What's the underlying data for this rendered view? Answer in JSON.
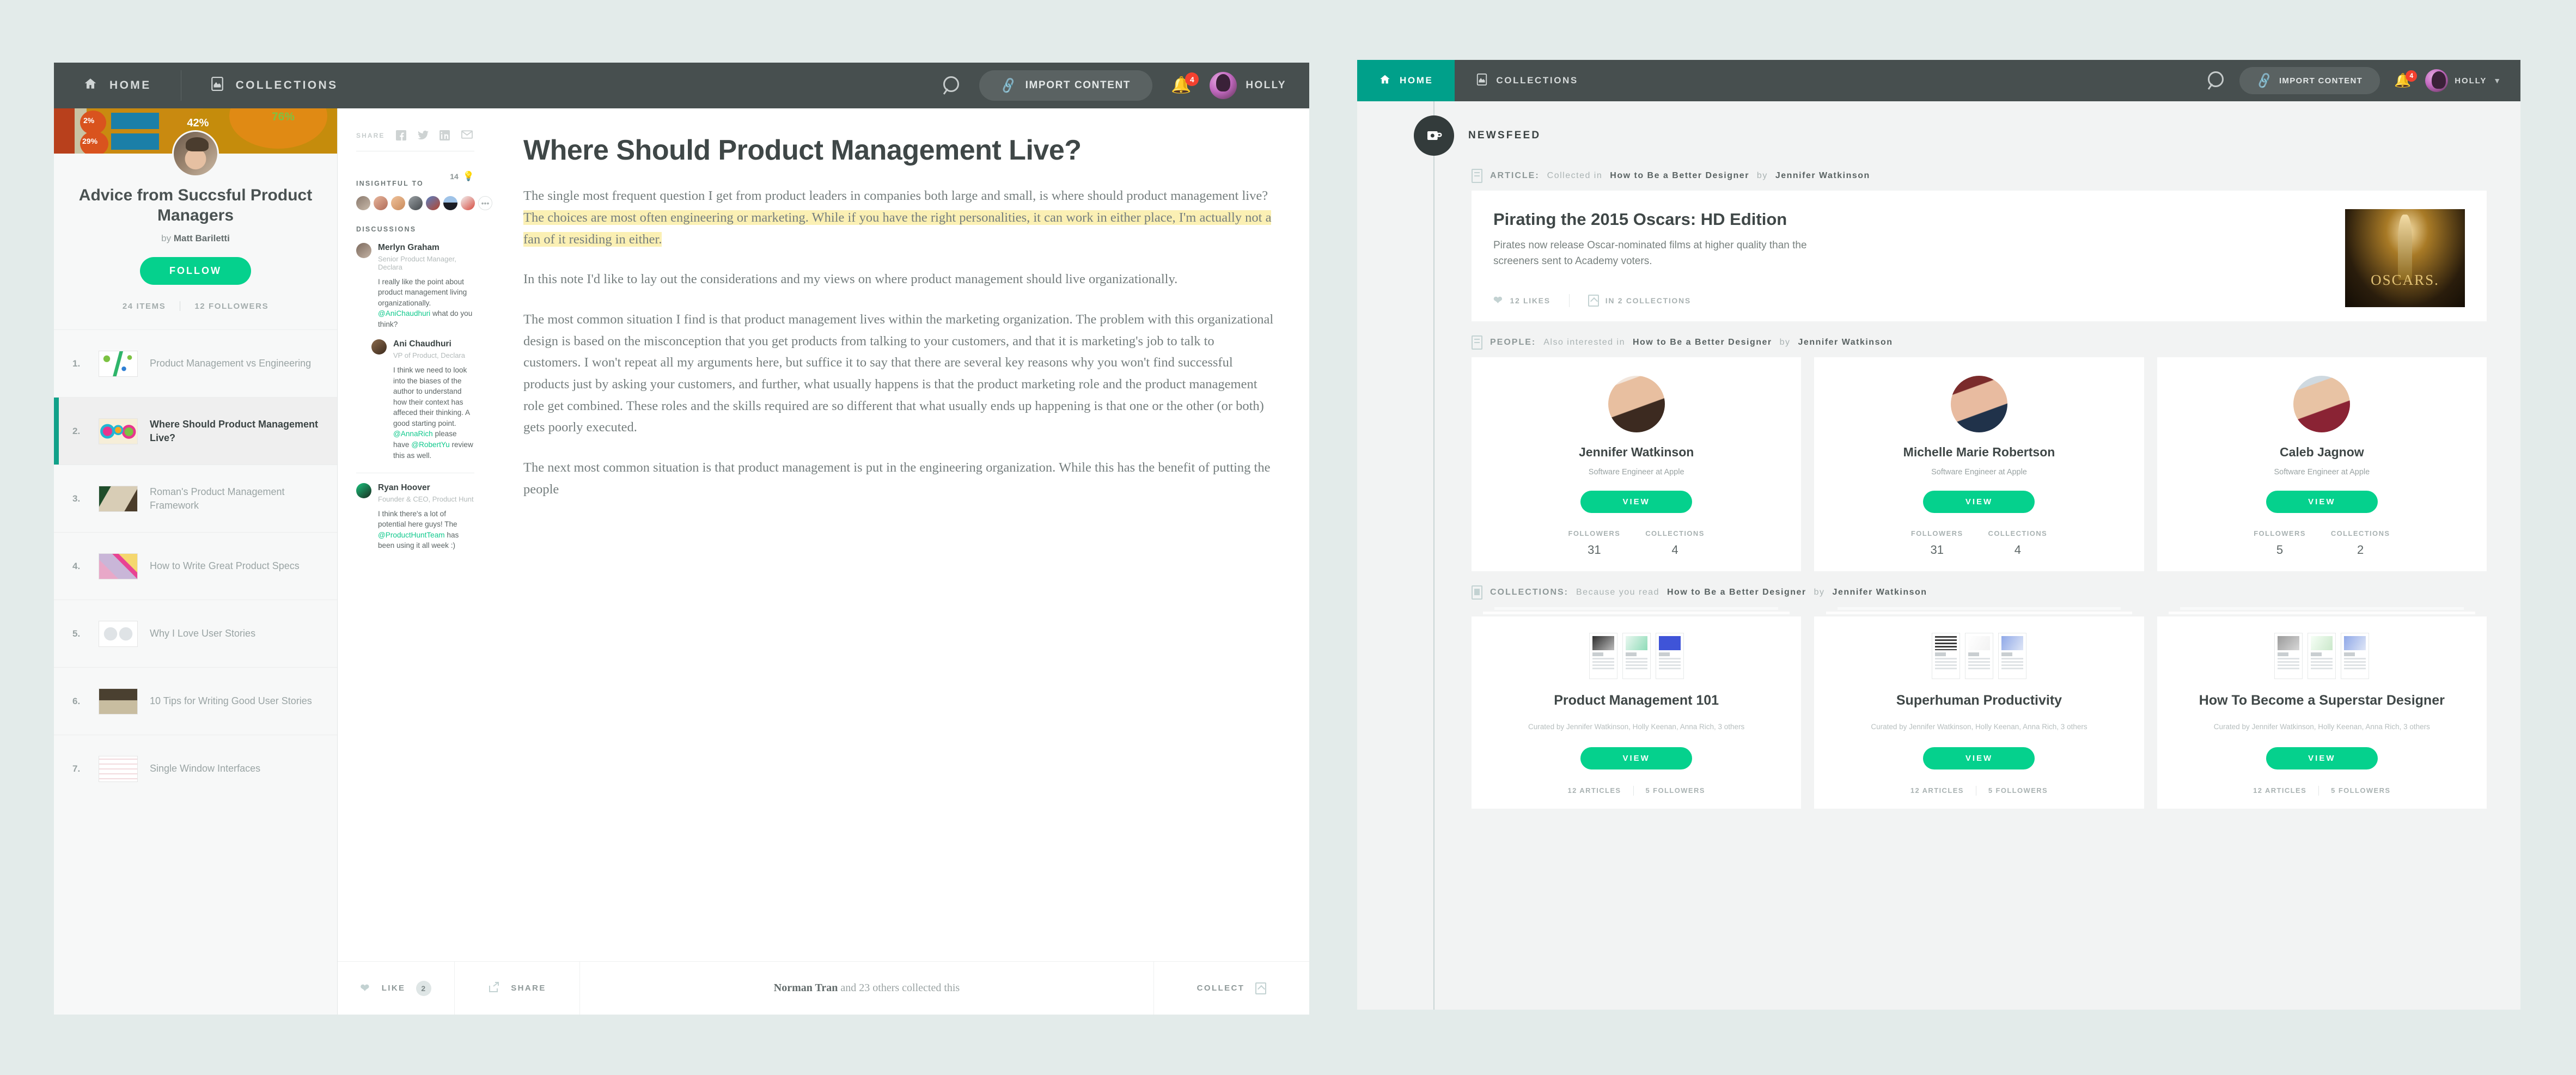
{
  "colors": {
    "teal": "#00a08a",
    "green": "#05d18d",
    "navbar": "#474f4f",
    "badge_red": "#f4412f",
    "highlight": "#fbf0b4"
  },
  "left_window": {
    "nav": {
      "home": "HOME",
      "collections": "COLLECTIONS",
      "import_label": "IMPORT CONTENT",
      "notification_count": "4",
      "user_name": "HOLLY"
    },
    "collection": {
      "title": "Advice from Succsful Product Managers",
      "by_label": "by",
      "author": "Matt Bariletti",
      "follow_label": "FOLLOW",
      "items_count": "24 ITEMS",
      "followers_count": "12 FOLLOWERS",
      "hero_stats": {
        "p1": "2%",
        "p2": "29%",
        "big": "42%",
        "right": "76%"
      },
      "items": [
        {
          "num": "1.",
          "label": "Product Management vs Engineering"
        },
        {
          "num": "2.",
          "label": "Where Should Product Management Live?"
        },
        {
          "num": "3.",
          "label": "Roman's Product Management Framework"
        },
        {
          "num": "4.",
          "label": "How to Write Great Product Specs"
        },
        {
          "num": "5.",
          "label": "Why I Love User Stories"
        },
        {
          "num": "6.",
          "label": "10 Tips for Writing Good User Stories"
        },
        {
          "num": "7.",
          "label": "Single Window Interfaces"
        }
      ]
    },
    "discussions_panel": {
      "share_label": "SHARE",
      "insightful_label": "INSIGHTFUL TO",
      "insightful_count": "14",
      "more_label": "•••",
      "discussions_label": "DISCUSSIONS",
      "comments": [
        {
          "name": "Merlyn Graham",
          "role": "Senior Product Manager, Declara",
          "body_1": "I really like the point about product management living organizationally. ",
          "mention_1": "@AniChaudhuri",
          "body_2": " what do you think?"
        },
        {
          "name": "Ani Chaudhuri",
          "role": "VP of Product, Declara",
          "body_1": "I think we need to look into the biases of the author to understand how their context has affeced their thinking. A good starting point. ",
          "mention_1": "@AnnaRich",
          "body_2": " please have ",
          "mention_2": "@RobertYu",
          "body_3": " review this as well."
        },
        {
          "name": "Ryan Hoover",
          "role": "Founder & CEO, Product Hunt",
          "body_1": "I think there's a lot of potential here guys! The ",
          "mention_1": "@ProductHuntTeam",
          "body_2": " has been using it all week :)"
        }
      ]
    },
    "article": {
      "title": "Where Should Product Management Live?",
      "p1_a": "The single most frequent question I get from product leaders in companies both large and small, is where should product management live? ",
      "p1_highlight": "The choices are most often engineering or marketing. While if you have the right personalities, it can work in either place, I'm actually not a fan of it residing in either.",
      "p2": "In this note I'd like to lay out the considerations and my views on where product management should live organizationally.",
      "p3": "The most common situation I find is that product management lives within the marketing organization. The problem with this organizational design is based on the misconception that you get products from talking to your customers, and that it is marketing's job to talk to customers. I won't repeat all my arguments here, but suffice it to say that there are several key reasons why you won't find successful products just by asking your customers, and further, what usually happens is that the product marketing role and the product management role get combined. These roles and the skills required are so different that what usually ends up happening is that one or the other (or both) gets poorly executed.",
      "p4": "The next most common situation is that product management is put in the engineering organization. While this has the benefit of putting the people"
    },
    "bottom_bar": {
      "like_label": "LIKE",
      "like_count": "2",
      "share_label": "SHARE",
      "collected_by": "Norman Tran",
      "collected_rest": " and 23 others collected this",
      "collect_label": "COLLECT"
    }
  },
  "right_window": {
    "nav": {
      "home": "HOME",
      "collections": "COLLECTIONS",
      "import_label": "IMPORT CONTENT",
      "notification_count": "4",
      "user_name": "HOLLY"
    },
    "newsfeed_label": "NEWSFEED",
    "sections": {
      "article": {
        "kind": "ARTICLE:",
        "prefix": "Collected in",
        "collection": "How to Be a Better Designer",
        "by_label": "by",
        "author": "Jennifer Watkinson",
        "card": {
          "title": "Pirating the 2015 Oscars: HD Edition",
          "desc": "Pirates now release Oscar-nominated films at higher quality than the screeners sent to Academy voters.",
          "likes": "12 LIKES",
          "collections": "IN 2 COLLECTIONS",
          "thumb_text": "OSCARS."
        }
      },
      "people": {
        "kind": "PEOPLE:",
        "prefix": "Also interested in",
        "collection": "How to Be a Better Designer",
        "by_label": "by",
        "author": "Jennifer Watkinson",
        "followers_label": "FOLLOWERS",
        "collections_label": "COLLECTIONS",
        "view_label": "VIEW",
        "cards": [
          {
            "name": "Jennifer Watkinson",
            "role": "Software Engineer at Apple",
            "followers": "31",
            "collections": "4"
          },
          {
            "name": "Michelle Marie Robertson",
            "role": "Software Engineer at Apple",
            "followers": "31",
            "collections": "4"
          },
          {
            "name": "Caleb Jagnow",
            "role": "Software Engineer at Apple",
            "followers": "5",
            "collections": "2"
          }
        ]
      },
      "collections": {
        "kind": "COLLECTIONS:",
        "prefix": "Because you read",
        "collection": "How to Be a Better Designer",
        "by_label": "by",
        "author": "Jennifer Watkinson",
        "view_label": "VIEW",
        "cards": [
          {
            "title": "Product Management 101",
            "curated": "Curated by Jennifer Watkinson, Holly Keenan, Anna Rich, 3 others",
            "articles": "12 ARTICLES",
            "followers": "5 FOLLOWERS"
          },
          {
            "title": "Superhuman Productivity",
            "curated": "Curated by Jennifer Watkinson, Holly Keenan, Anna Rich, 3 others",
            "articles": "12 ARTICLES",
            "followers": "5 FOLLOWERS"
          },
          {
            "title": "How To Become a Superstar Designer",
            "curated": "Curated by Jennifer Watkinson, Holly Keenan, Anna Rich, 3 others",
            "articles": "12 ARTICLES",
            "followers": "5 FOLLOWERS"
          }
        ]
      }
    }
  }
}
